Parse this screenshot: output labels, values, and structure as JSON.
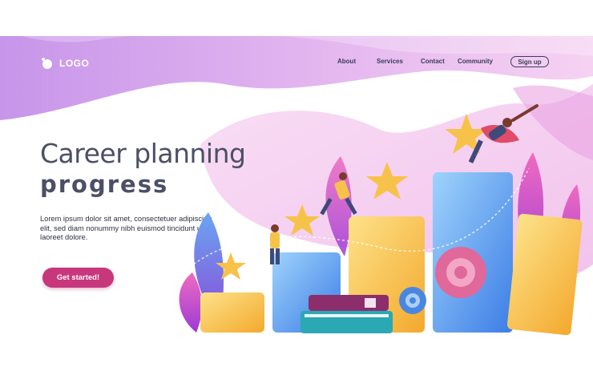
{
  "header": {
    "logo_text": "LOGO",
    "logo_icon": "logo-mark-icon",
    "nav": {
      "about": "About",
      "services": "Services",
      "contact": "Contact",
      "community": "Community",
      "signup": "Sign up"
    }
  },
  "hero": {
    "title_line1": "Career planning",
    "title_line2": "progress",
    "description": "Lorem ipsum dolor sit amet, consectetuer adipiscing elit, sed diam nonummy nibh euismod tincidunt ut laoreet dolore.",
    "cta": "Get started!"
  },
  "colors": {
    "accent": "#c8367c",
    "text_dark": "#4c4f66",
    "wave_purple": "#c99be8",
    "wave_pink": "#f3c2ea",
    "bar_blue": "#5b9ee9",
    "bar_yellow": "#f7c536"
  },
  "illustration": {
    "icons": [
      "star-icon",
      "gear-icon",
      "book-icon",
      "leaf-icon",
      "person-icon",
      "superhero-icon"
    ]
  }
}
